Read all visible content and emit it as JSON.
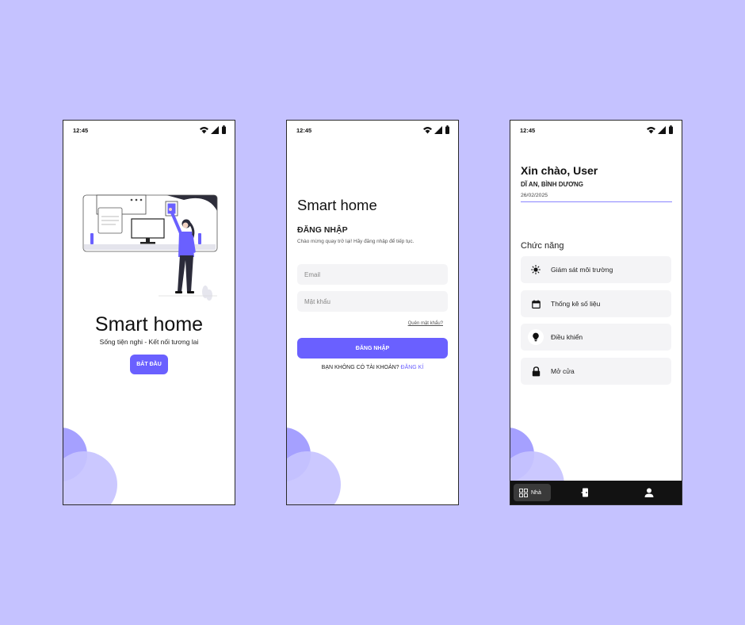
{
  "status_time": "12:45",
  "welcome": {
    "title": "Smart home",
    "subtitle": "Sống tiện nghi  - Kết nối tương lai",
    "start_button": "BẮT ĐẦU"
  },
  "login": {
    "title": "Smart home",
    "heading": "ĐĂNG NHẬP",
    "description": "Chào mừng quay trở lại! Hãy đăng nhập để tiếp tục.",
    "email_placeholder": "Email",
    "password_placeholder": "Mật khẩu",
    "forgot": "Quên mật khẩu?",
    "login_button": "ĐĂNG NHẬP",
    "no_account": "BẠN KHÔNG CÓ TÀI KHOẢN?",
    "signup": "ĐĂNG KÍ"
  },
  "home": {
    "greeting": "Xin chào, User",
    "location": "DĨ AN, BÌNH DƯƠNG",
    "date": "26/02/2025",
    "functions_heading": "Chức năng",
    "functions": [
      {
        "label": "Giám sát môi trường",
        "icon": "sun-icon"
      },
      {
        "label": "Thống kê số liệu",
        "icon": "calendar-icon"
      },
      {
        "label": "Điều khiển",
        "icon": "lightbulb-icon"
      },
      {
        "label": "Mở cửa",
        "icon": "lock-icon"
      }
    ],
    "nav": {
      "home_label": "Nhà",
      "home_icon": "grid-icon",
      "middle_icon": "door-icon",
      "profile_icon": "user-icon"
    }
  },
  "colors": {
    "background": "#c5c2ff",
    "accent": "#6a60ff",
    "blob_dark": "#a5a0ff",
    "blob_light": "#c7c3ff",
    "nav_bar": "#121212"
  }
}
